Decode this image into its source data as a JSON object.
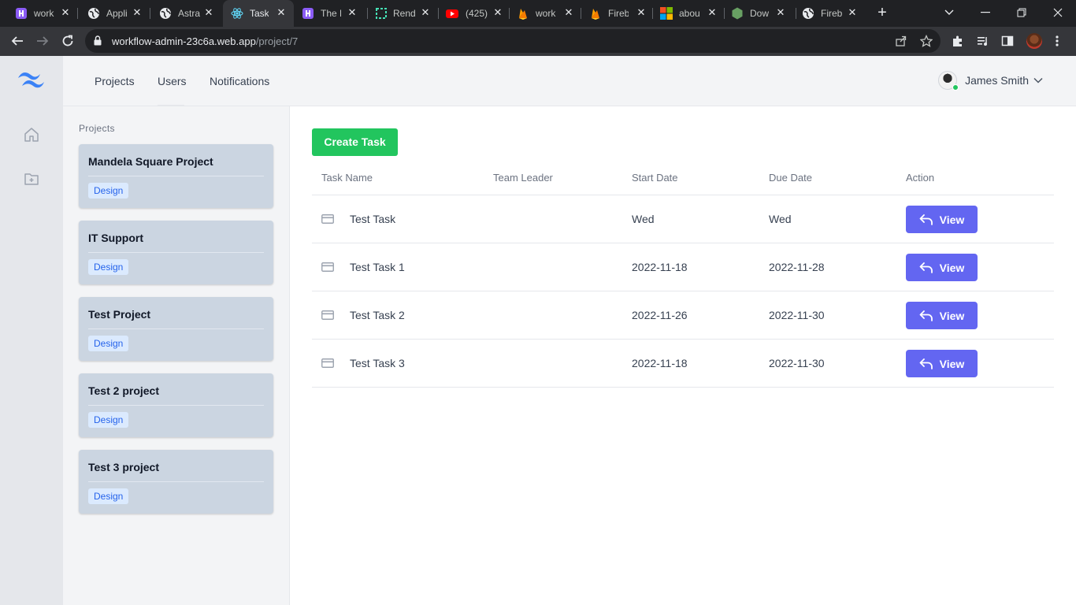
{
  "browser": {
    "tabs": [
      {
        "title": "work",
        "icon": "hashnode-icon",
        "active": false
      },
      {
        "title": "Appli",
        "icon": "globe-icon",
        "active": false
      },
      {
        "title": "Astra",
        "icon": "globe-icon",
        "active": false
      },
      {
        "title": "Task I",
        "icon": "react-icon",
        "active": true
      },
      {
        "title": "The H",
        "icon": "hashnode-icon",
        "active": false
      },
      {
        "title": "Rend",
        "icon": "render-icon",
        "active": false
      },
      {
        "title": "(425)",
        "icon": "youtube-icon",
        "active": false
      },
      {
        "title": "work",
        "icon": "firebase-icon",
        "active": false
      },
      {
        "title": "Fireb",
        "icon": "firebase-icon",
        "active": false
      },
      {
        "title": "abou",
        "icon": "microsoft-icon",
        "active": false
      },
      {
        "title": "Dow",
        "icon": "nodejs-icon",
        "active": false
      },
      {
        "title": "Fireb",
        "icon": "globe-icon",
        "active": false
      }
    ],
    "url": {
      "host": "workflow-admin-23c6a.web.app",
      "path": "/project/7"
    }
  },
  "nav": {
    "links": [
      "Projects",
      "Users",
      "Notifications"
    ],
    "user_name": "James Smith"
  },
  "sidebar": {
    "heading": "Projects",
    "projects": [
      {
        "name": "Mandela Square Project",
        "badge": "Design"
      },
      {
        "name": "IT Support",
        "badge": "Design"
      },
      {
        "name": "Test Project",
        "badge": "Design"
      },
      {
        "name": "Test 2 project",
        "badge": "Design"
      },
      {
        "name": "Test 3 project",
        "badge": "Design"
      }
    ]
  },
  "main": {
    "create_label": "Create Task",
    "columns": [
      "Task Name",
      "Team Leader",
      "Start Date",
      "Due Date",
      "Action"
    ],
    "tasks": [
      {
        "name": "Test Task",
        "leader": "",
        "start": "Wed",
        "due": "Wed",
        "action": "View"
      },
      {
        "name": "Test Task 1",
        "leader": "",
        "start": "2022-11-18",
        "due": "2022-11-28",
        "action": "View"
      },
      {
        "name": "Test Task 2",
        "leader": "",
        "start": "2022-11-26",
        "due": "2022-11-30",
        "action": "View"
      },
      {
        "name": "Test Task 3",
        "leader": "",
        "start": "2022-11-18",
        "due": "2022-11-30",
        "action": "View"
      }
    ]
  },
  "colors": {
    "create_button": "#22c55e",
    "view_button": "#6366f1",
    "project_card": "#cbd5e1",
    "badge_bg": "#dbeafe",
    "badge_text": "#2563eb"
  }
}
